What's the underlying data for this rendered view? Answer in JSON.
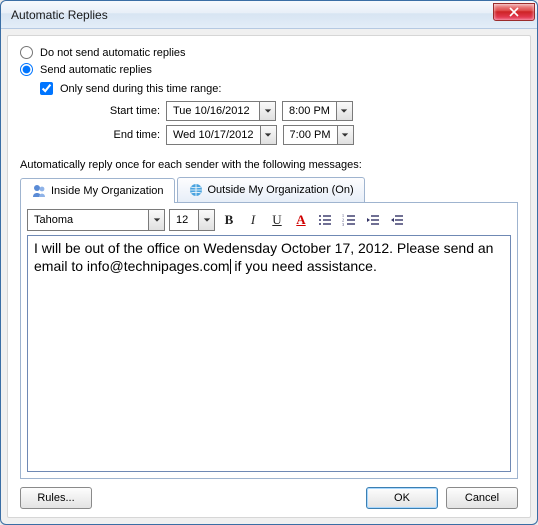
{
  "window": {
    "title": "Automatic Replies"
  },
  "radios": {
    "dont_send": "Do not send automatic replies",
    "send": "Send automatic replies",
    "selected": "send"
  },
  "time_range": {
    "checkbox_label": "Only send during this time range:",
    "checked": true,
    "start_label": "Start time:",
    "end_label": "End time:",
    "start_date": "Tue 10/16/2012",
    "start_time": "8:00 PM",
    "end_date": "Wed 10/17/2012",
    "end_time": "7:00 PM"
  },
  "section_label": "Automatically reply once for each sender with the following messages:",
  "tabs": {
    "inside": "Inside My Organization",
    "outside": "Outside My Organization (On)",
    "active": "inside"
  },
  "editor": {
    "font_name": "Tahoma",
    "font_size": "12",
    "body_before": "I will be out of the office on Wedensday October 17, 2012. Please send an email to info@technipages.com",
    "body_after": " if you need assistance."
  },
  "buttons": {
    "rules": "Rules...",
    "ok": "OK",
    "cancel": "Cancel"
  }
}
